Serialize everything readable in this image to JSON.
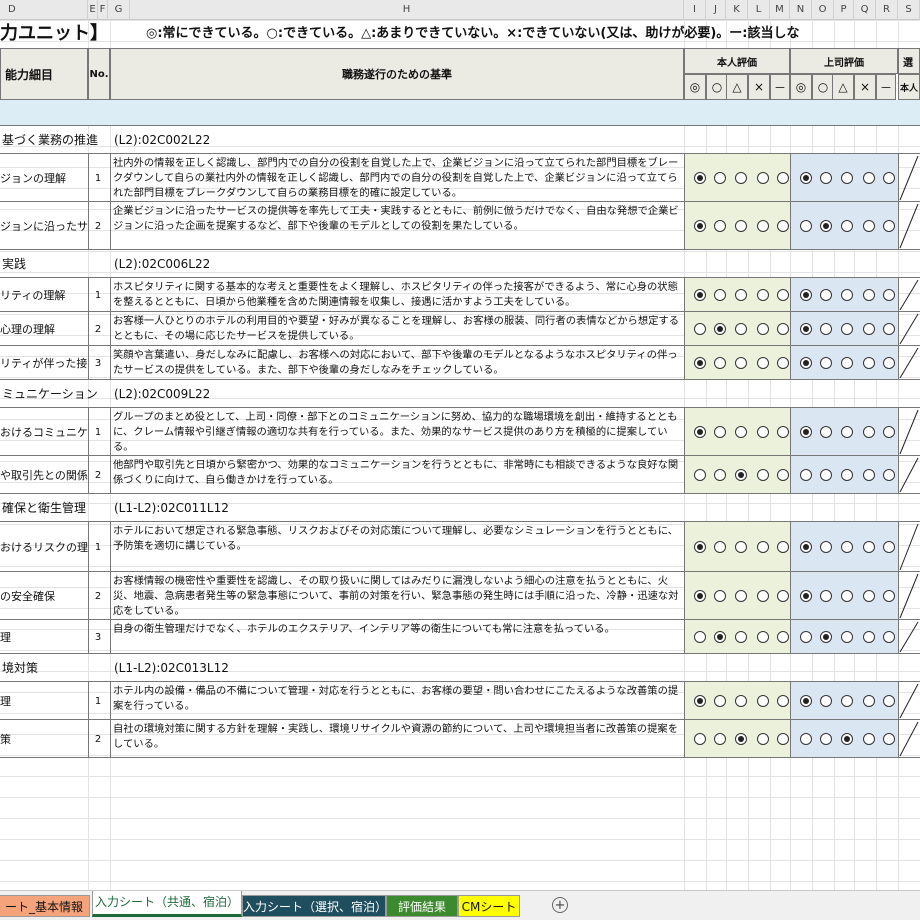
{
  "columns": [
    "D",
    "E",
    "F",
    "G",
    "H",
    "I",
    "J",
    "K",
    "L",
    "M",
    "N",
    "O",
    "P",
    "Q",
    "R",
    "S"
  ],
  "title": {
    "unit": "力ユニット】",
    "legend": "◎:常にできている。○:できている。△:あまりできていない。×:できていない(又は、助けが必要)。ー:該当しな"
  },
  "header": {
    "col_d": "能力細目",
    "col_no": "No.",
    "col_h": "職務遂行のための基準",
    "self_eval": "本人評価",
    "boss_eval": "上司評価",
    "select": "選",
    "select_sub": "本人",
    "symbols": [
      "◎",
      "○",
      "△",
      "×",
      "－"
    ]
  },
  "sections": [
    {
      "title": "基づく業務の推進",
      "code": "(L2):02C002L22",
      "rows": [
        {
          "label": "ジョンの理解",
          "no": "1",
          "text": "社内外の情報を正しく認識し、部門内での自分の役割を自覚した上で、企業ビジョンに沿って立てられた部門目標をブレークダウンして自らの業社内外の情報を正しく認識し、部門内での自分の役割を自覚した上で、企業ビジョンに沿って立てられた部門目標をブレークダウンして自らの業務目標を的確に設定している。",
          "self": 0,
          "boss": 0
        },
        {
          "label": "ジョンに沿ったサー\n等",
          "no": "2",
          "text": "企業ビジョンに沿ったサービスの提供等を率先して工夫・実践するとともに、前例に倣うだけでなく、自由な発想で企業ビジョンに沿った企画を提案するなど、部下や後輩のモデルとしての役割を果たしている。",
          "self": 0,
          "boss": 1
        }
      ]
    },
    {
      "title": "実践",
      "code": "(L2):02C006L22",
      "rows": [
        {
          "label": "リティの理解",
          "no": "1",
          "text": "ホスピタリティに関する基本的な考えと重要性をよく理解し、ホスピタリティの伴った接客ができるよう、常に心身の状態を整えるとともに、日頃から他業種を含めた関連情報を収集し、接遇に活かすよう工夫をしている。",
          "self": 0,
          "boss": 0
        },
        {
          "label": "心理の理解",
          "no": "2",
          "text": "お客様一人ひとりのホテルの利用目的や要望・好みが異なることを理解し、お客様の服装、同行者の表情などから想定するとともに、その場に応じたサービスを提供している。",
          "self": 1,
          "boss": 0
        },
        {
          "label": "リティが伴った接",
          "no": "3",
          "text": "笑顔や言葉遣い、身だしなみに配慮し、お客様への対応において、部下や後輩のモデルとなるようなホスピタリティの伴ったサービスの提供をしている。また、部下や後輩の身だしなみをチェックしている。",
          "self": 0,
          "boss": 0
        }
      ]
    },
    {
      "title": "ミュニケーション",
      "code": "(L2):02C009L22",
      "rows": [
        {
          "label": "おけるコミュニケー",
          "no": "1",
          "text": "グループのまとめ役として、上司・同僚・部下とのコミュニケーションに努め、協力的な職場環境を創出・維持するとともに、クレーム情報や引継ぎ情報の適切な共有を行っている。また、効果的なサービス提供のあり方を積極的に提案している。",
          "self": 0,
          "boss": 0
        },
        {
          "label": "や取引先との関係",
          "no": "2",
          "text": "他部門や取引先と日頃から緊密かつ、効果的なコミュニケーションを行うとともに、非常時にも相談できるような良好な関係づくりに向けて、自ら働きかけを行っている。",
          "self": 2,
          "boss": -1
        }
      ]
    },
    {
      "title": "確保と衛生管理",
      "code": "(L1-L2):02C011L12",
      "rows": [
        {
          "label": "おけるリスクの理",
          "no": "1",
          "text": "ホテルにおいて想定される緊急事態、リスクおよびその対応策について理解し、必要なシミュレーションを行うとともに、予防策を適切に講じている。",
          "self": 0,
          "boss": 0
        },
        {
          "label": "の安全確保",
          "no": "2",
          "text": "お客様情報の機密性や重要性を認識し、その取り扱いに関してはみだりに漏洩しないよう細心の注意を払うとともに、火災、地震、急病患者発生等の緊急事態について、事前の対策を行い、緊急事態の発生時には手順に沿った、冷静・迅速な対応をしている。",
          "self": 0,
          "boss": 0
        },
        {
          "label": "理",
          "no": "3",
          "text": "自身の衛生管理だけでなく、ホテルのエクステリア、インテリア等の衛生についても常に注意を払っている。",
          "self": 1,
          "boss": 1
        }
      ]
    },
    {
      "title": "境対策",
      "code": "(L1-L2):02C013L12",
      "rows": [
        {
          "label": "理",
          "no": "1",
          "text": "ホテル内の設備・備品の不備について管理・対応を行うとともに、お客様の要望・問い合わせにこたえるような改善策の提案を行っている。",
          "self": 0,
          "boss": 0
        },
        {
          "label": "策",
          "no": "2",
          "text": "自社の環境対策に関する方針を理解・実践し、環境リサイクルや資源の節約について、上司や環境担当者に改善策の提案をしている。",
          "self": 2,
          "boss": 2
        }
      ]
    }
  ],
  "tabs": [
    {
      "label": "ート_基本情報",
      "bg": "#f4a37a",
      "fg": "#111"
    },
    {
      "label": "入力シート（共通、宿泊）",
      "bg": "#ffffff",
      "fg": "#1e6b3a"
    },
    {
      "label": "入力シート（選択、宿泊）",
      "bg": "#1f4e5f",
      "fg": "#ffffff"
    },
    {
      "label": "評価結果",
      "bg": "#3c8a2e",
      "fg": "#ffffff"
    },
    {
      "label": "CMシート",
      "bg": "#ffff00",
      "fg": "#111"
    }
  ],
  "add_sheet_icon": "plus-circle-icon",
  "colors": {
    "self_bg": "#ecf1dc",
    "boss_bg": "#dbe6f3",
    "band": "#dcedf5"
  }
}
